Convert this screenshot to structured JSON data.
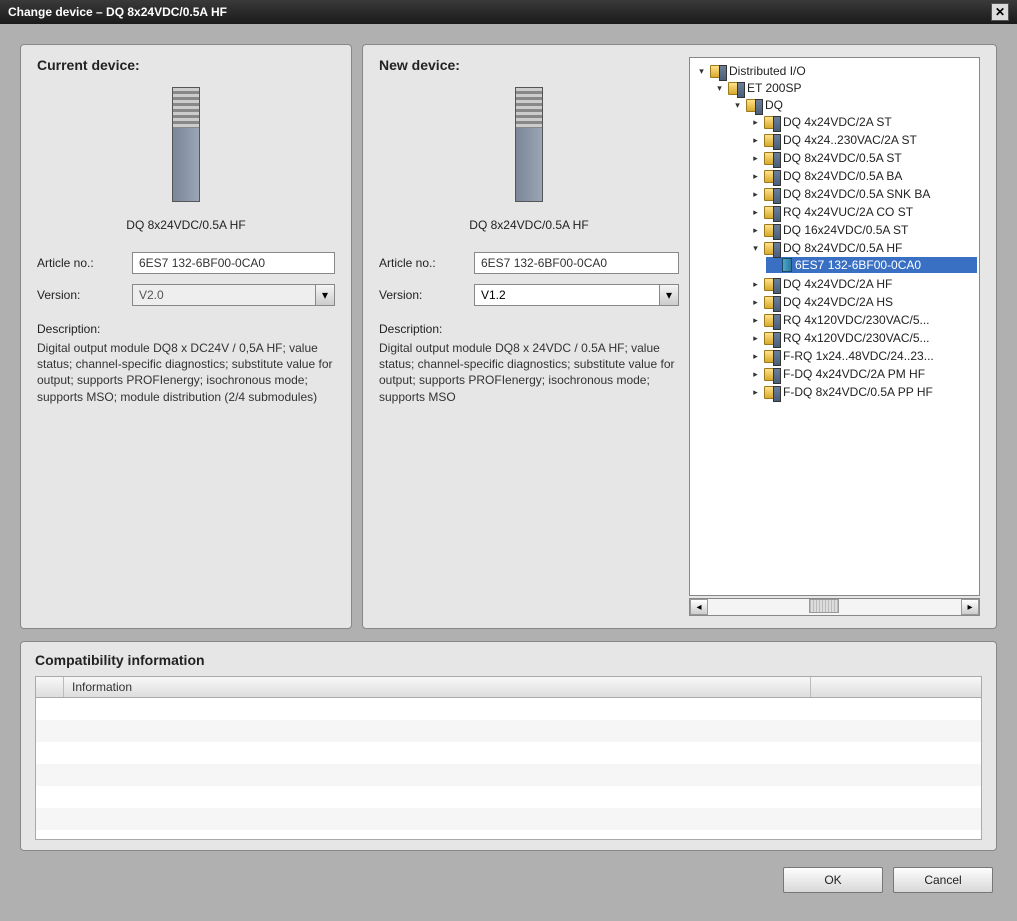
{
  "window": {
    "title": "Change device – DQ 8x24VDC/0.5A HF"
  },
  "current": {
    "heading": "Current device:",
    "device_name": "DQ 8x24VDC/0.5A HF",
    "article_label": "Article no.:",
    "article_value": "6ES7 132-6BF00-0CA0",
    "version_label": "Version:",
    "version_value": "V2.0",
    "desc_label": "Description:",
    "desc_text": "Digital output module DQ8 x DC24V / 0,5A HF; value status; channel-specific diagnostics; substitute value for output; supports PROFIenergy; isochronous mode; supports MSO; module distribution (2/4 submodules)"
  },
  "newdev": {
    "heading": "New device:",
    "device_name": "DQ 8x24VDC/0.5A HF",
    "article_label": "Article no.:",
    "article_value": "6ES7 132-6BF00-0CA0",
    "version_label": "Version:",
    "version_value": "V1.2",
    "desc_label": "Description:",
    "desc_text": "Digital output module DQ8 x 24VDC / 0.5A HF; value status; channel-specific diagnostics; substitute value for output; supports PROFIenergy; isochronous mode; supports MSO"
  },
  "tree": {
    "root": "Distributed I/O",
    "l1": "ET 200SP",
    "l2": "DQ",
    "items": [
      "DQ 4x24VDC/2A ST",
      "DQ 4x24..230VAC/2A ST",
      "DQ 8x24VDC/0.5A ST",
      "DQ 8x24VDC/0.5A BA",
      "DQ 8x24VDC/0.5A SNK BA",
      "RQ 4x24VUC/2A CO ST",
      "DQ 16x24VDC/0.5A ST",
      "DQ 8x24VDC/0.5A HF",
      "DQ 4x24VDC/2A HF",
      "DQ 4x24VDC/2A HS",
      "RQ 4x120VDC/230VAC/5...",
      "RQ 4x120VDC/230VAC/5...",
      "F-RQ 1x24..48VDC/24..23...",
      "F-DQ 4x24VDC/2A PM HF",
      "F-DQ 8x24VDC/0.5A PP HF"
    ],
    "selected_child": "6ES7 132-6BF00-0CA0"
  },
  "compat": {
    "heading": "Compatibility information",
    "col_info": "Information"
  },
  "buttons": {
    "ok": "OK",
    "cancel": "Cancel"
  }
}
